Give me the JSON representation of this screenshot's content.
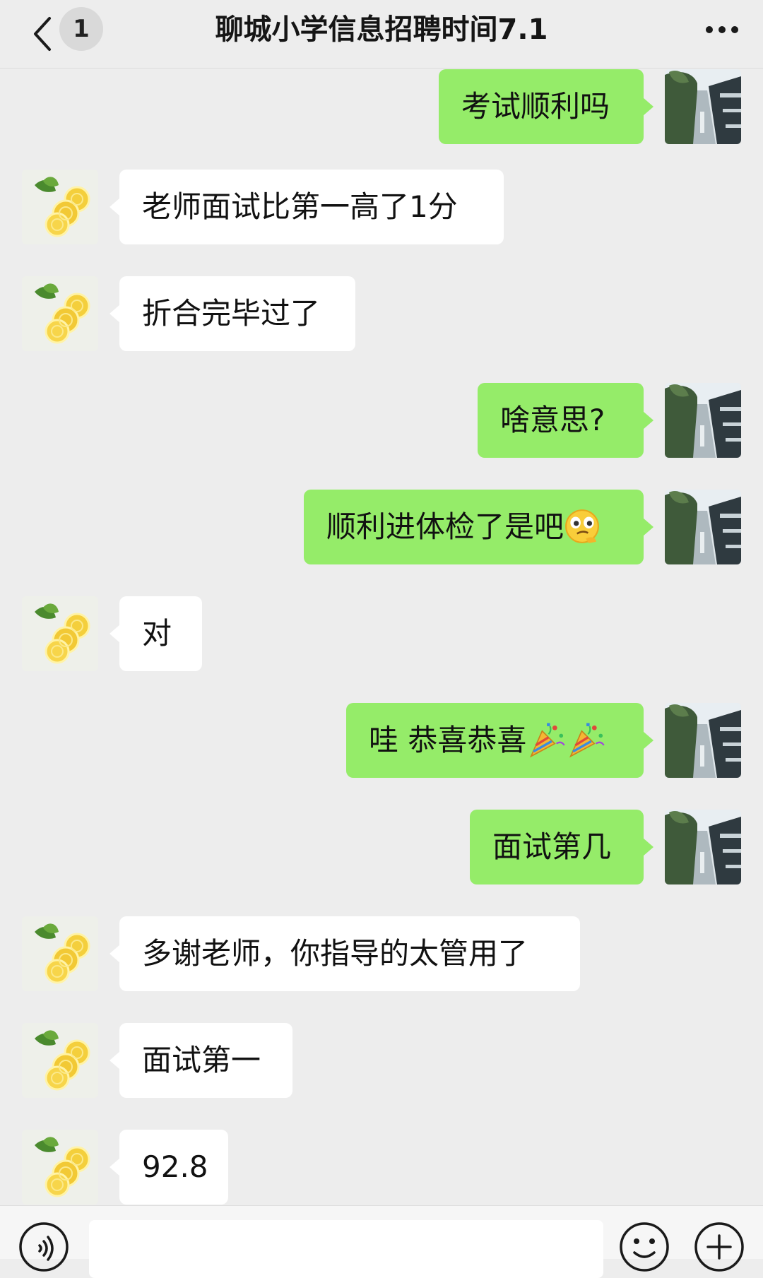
{
  "header": {
    "back_icon": "chevron-left-icon",
    "unread_count": "1",
    "title": "聊城小学信息招聘时间7.1",
    "more_icon": "more-dots-icon"
  },
  "contact_avatar": "lemon-slices-image",
  "my_avatar": "canal-town-image",
  "messages": [
    {
      "side": "out",
      "text": "考试顺利吗"
    },
    {
      "side": "in",
      "text": "老师面试比第一高了1分"
    },
    {
      "side": "in",
      "text": "折合完毕过了"
    },
    {
      "side": "out",
      "text": "啥意思?"
    },
    {
      "side": "out",
      "text": "顺利进体检了是吧",
      "emoji": "smirk-emoji"
    },
    {
      "side": "in",
      "text": "对"
    },
    {
      "side": "out",
      "text": "哇 恭喜恭喜",
      "emoji": "party-popper-emoji x2"
    },
    {
      "side": "out",
      "text": "面试第几"
    },
    {
      "side": "in",
      "text": "多谢老师，你指导的太管用了"
    },
    {
      "side": "in",
      "text": "面试第一"
    },
    {
      "side": "in",
      "text": "92.8"
    }
  ],
  "input_bar": {
    "voice_icon": "voice-icon",
    "emoji_icon": "emoji-face-icon",
    "plus_icon": "plus-circle-icon",
    "text_value": ""
  },
  "colors": {
    "background": "#ededed",
    "incoming_bubble": "#ffffff",
    "outgoing_bubble": "#95ec69"
  }
}
